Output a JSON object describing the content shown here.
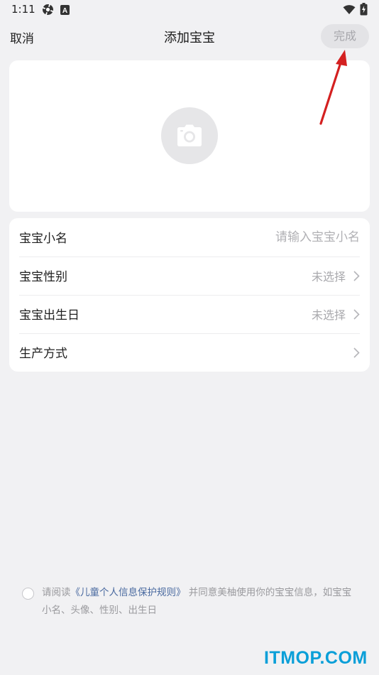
{
  "status_bar": {
    "time": "1:11",
    "icons": [
      "gear-icon",
      "a-badge-icon",
      "wifi-icon",
      "battery-icon"
    ],
    "a_badge_letter": "A"
  },
  "header": {
    "cancel_label": "取消",
    "title": "添加宝宝",
    "done_label": "完成"
  },
  "photo_card": {
    "icon": "camera-icon"
  },
  "form": {
    "rows": [
      {
        "label": "宝宝小名",
        "placeholder": "请输入宝宝小名",
        "value": ""
      },
      {
        "label": "宝宝性别",
        "value": "未选择"
      },
      {
        "label": "宝宝出生日",
        "value": "未选择"
      },
      {
        "label": "生产方式",
        "value": ""
      }
    ]
  },
  "agreement": {
    "prefix": "请阅读",
    "link": "《儿童个人信息保护规则》",
    "suffix": "并同意美柚使用你的宝宝信息，如宝宝小名、头像、性别、出生日",
    "checked": false
  },
  "watermark": "ITMOP.COM",
  "colors": {
    "background": "#f1f1f3",
    "card": "#ffffff",
    "link": "#4a6aa0",
    "annotation_arrow": "#d42020",
    "watermark": "#0a9fd8"
  }
}
